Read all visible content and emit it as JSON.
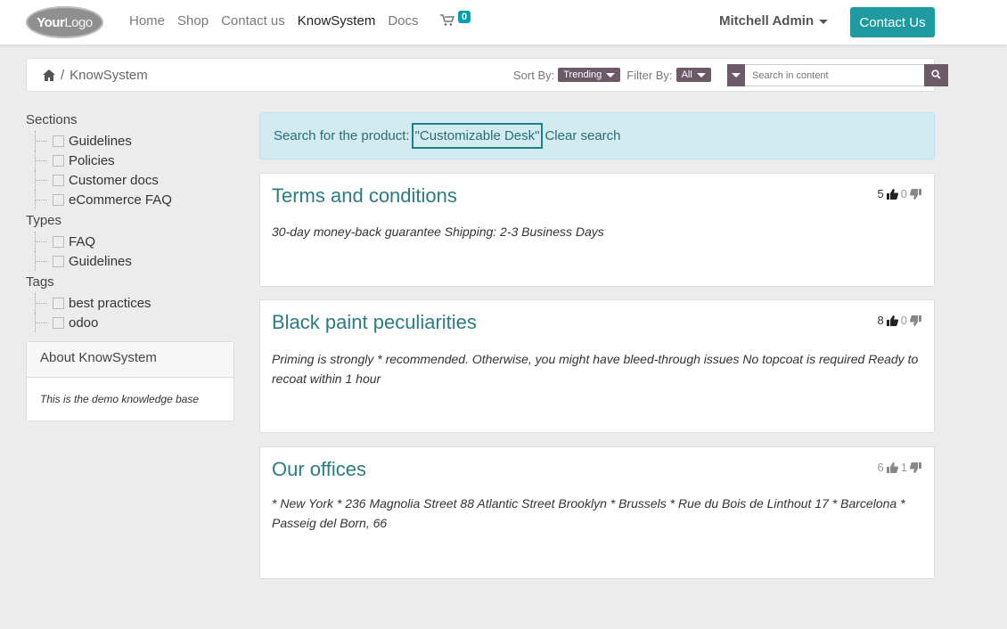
{
  "nav": {
    "logo_bold": "Your",
    "logo_light": "Logo",
    "links": [
      "Home",
      "Shop",
      "Contact us",
      "KnowSystem",
      "Docs"
    ],
    "cart_count": "0",
    "user": "Mitchell Admin",
    "contact_button": "Contact Us"
  },
  "breadcrumb": {
    "current": "KnowSystem",
    "separator": "/",
    "sort_label": "Sort By:",
    "sort_value": "Trending",
    "filter_label": "Filter By:",
    "filter_value": "All",
    "search_placeholder": "Search in content"
  },
  "sidebar": {
    "sections_title": "Sections",
    "sections": [
      "Guidelines",
      "Policies",
      "Customer docs",
      "eCommerce FAQ"
    ],
    "types_title": "Types",
    "types": [
      "FAQ",
      "Guidelines"
    ],
    "tags_title": "Tags",
    "tags": [
      "best practices",
      "odoo"
    ],
    "about_title": "About KnowSystem",
    "about_text": "This is the demo knowledge base"
  },
  "alert": {
    "prefix": "Search for the product:",
    "query": "\"Customizable Desk\"",
    "clear": "Clear search"
  },
  "articles": [
    {
      "title": "Terms and conditions",
      "likes": "5",
      "dislikes": "0",
      "text": "30-day money-back guarantee Shipping: 2-3 Business Days"
    },
    {
      "title": "Black paint peculiarities",
      "likes": "8",
      "dislikes": "0",
      "text": "Priming is strongly * recommended. Otherwise, you might have bleed-through issues No topcoat is required Ready to recoat within 1 hour"
    },
    {
      "title": "Our offices",
      "likes": "6",
      "dislikes": "1",
      "text": "* New York * 236 Magnolia Street 88 Atlantic Street Brooklyn * Brussels * Rue du Bois de Linthout 17 * Barcelona * Passeig del Born, 66"
    }
  ],
  "colors": {
    "primary": "#1f9aa0",
    "title": "#2a7c84",
    "pill": "#6b5a68",
    "alert_bg": "#d2ebf1"
  }
}
